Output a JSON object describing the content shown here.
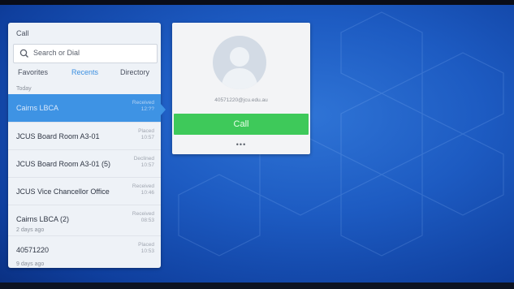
{
  "panel": {
    "title": "Call",
    "search_placeholder": "Search or Dial",
    "tabs": [
      {
        "label": "Favorites",
        "active": false
      },
      {
        "label": "Recents",
        "active": true
      },
      {
        "label": "Directory",
        "active": false
      }
    ],
    "sections": {
      "today": "Today",
      "two_days": "2 days ago",
      "nine_days": "9 days ago"
    },
    "rows": [
      {
        "name": "Cairns LBCA",
        "status": "Received",
        "time": "12:??",
        "selected": true
      },
      {
        "name": "JCUS Board Room A3-01",
        "status": "Placed",
        "time": "10:57",
        "selected": false
      },
      {
        "name": "JCUS Board Room A3-01 (5)",
        "status": "Declined",
        "time": "10:57",
        "selected": false
      },
      {
        "name": "JCUS Vice Chancellor Office",
        "status": "Received",
        "time": "10:46",
        "selected": false
      },
      {
        "name": "Cairns LBCA (2)",
        "status": "Received",
        "time": "08:53",
        "selected": false
      },
      {
        "name": "40571220",
        "status": "Placed",
        "time": "10:53",
        "selected": false
      }
    ]
  },
  "card": {
    "address": "40571220@jcu.edu.au",
    "call_label": "Call",
    "more_label": "•••"
  },
  "colors": {
    "accent": "#3e93e4",
    "call_green": "#3ec95a",
    "background_blue": "#1d5bc2"
  },
  "icons": [
    "search-icon",
    "avatar-placeholder-icon",
    "more-icon"
  ]
}
